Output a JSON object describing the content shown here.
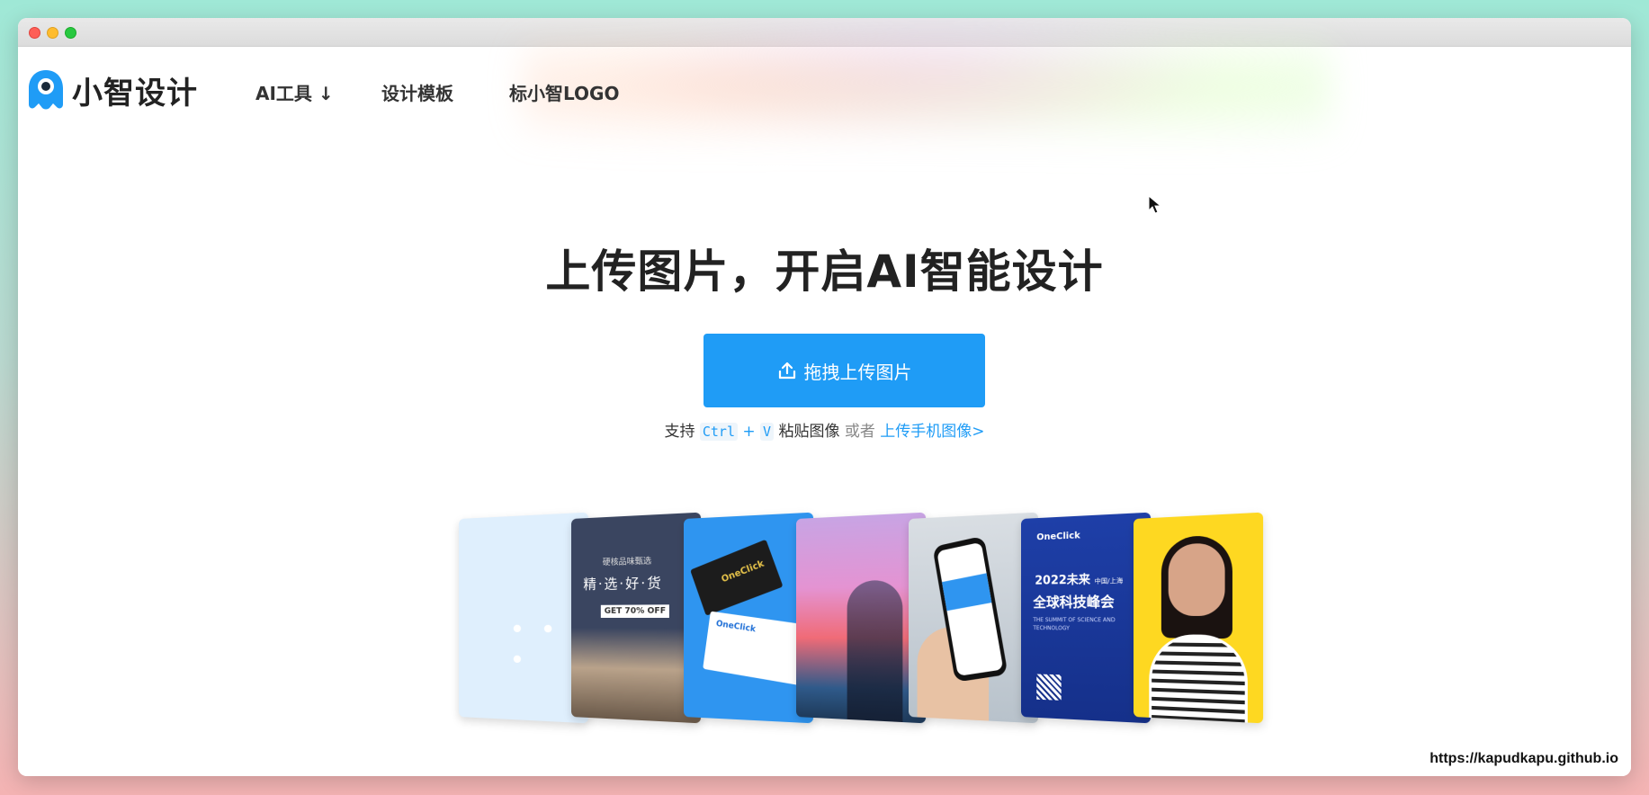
{
  "window": {
    "controls": [
      "close",
      "minimize",
      "maximize"
    ]
  },
  "header": {
    "logo_text": "小智设计",
    "logo_icon": "mascot-icon",
    "nav": [
      {
        "label": "AI工具 ↓"
      },
      {
        "label": "设计模板"
      },
      {
        "label": "标小智LOGO"
      }
    ]
  },
  "hero": {
    "headline": "上传图片，开启AI智能设计",
    "upload_button": {
      "label": "拖拽上传图片",
      "icon": "upload-icon"
    },
    "hint": {
      "prefix": "支持",
      "key1": "Ctrl",
      "plus": "+",
      "key2": "V",
      "paste": "粘贴图像",
      "or": "或者",
      "mobile_link": "上传手机图像>"
    }
  },
  "examples": {
    "more": "• • •",
    "card1": {
      "small": "硬核品味甄选",
      "title": "精·选·好·货",
      "tag": "GET 70% OFF"
    },
    "card2": {
      "brand": "OneClick"
    },
    "card5": {
      "brand": "OneClick",
      "year": "2022未来",
      "place": "中国/上海",
      "title": "全球科技峰会",
      "subtitle": "THE SUMMIT OF SCIENCE AND TECHNOLOGY"
    }
  },
  "watermark": "https://kapudkapu.github.io",
  "colors": {
    "accent": "#1f9cf6",
    "headline": "#222222"
  }
}
